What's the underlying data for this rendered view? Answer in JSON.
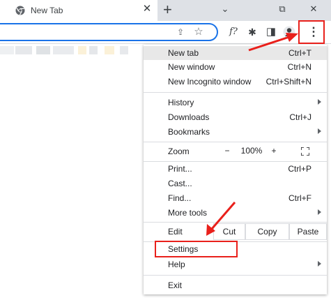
{
  "tab": {
    "title": "New Tab",
    "close": "✕",
    "new_tab": "+"
  },
  "window": {
    "minimize": "⌄",
    "maximize": "⧉",
    "close": "✕"
  },
  "toolbar": {
    "share_glyph": "⇪",
    "bookmark_glyph": "☆",
    "ext_f": "f?",
    "puzzle_glyph": "✱",
    "sidepanel_glyph": "◨",
    "kebab_glyph": "⋮"
  },
  "menu": {
    "group1": [
      {
        "label": "New tab",
        "shortcut": "Ctrl+T"
      },
      {
        "label": "New window",
        "shortcut": "Ctrl+N"
      },
      {
        "label": "New Incognito window",
        "shortcut": "Ctrl+Shift+N"
      }
    ],
    "group2": [
      {
        "label": "History",
        "shortcut": ""
      },
      {
        "label": "Downloads",
        "shortcut": "Ctrl+J"
      },
      {
        "label": "Bookmarks",
        "shortcut": ""
      }
    ],
    "zoom": {
      "label": "Zoom",
      "minus": "−",
      "value": "100%",
      "plus": "+"
    },
    "group3": [
      {
        "label": "Print...",
        "shortcut": "Ctrl+P"
      },
      {
        "label": "Cast...",
        "shortcut": ""
      },
      {
        "label": "Find...",
        "shortcut": "Ctrl+F"
      },
      {
        "label": "More tools",
        "shortcut": ""
      }
    ],
    "edit": {
      "label": "Edit",
      "cut": "Cut",
      "copy": "Copy",
      "paste": "Paste"
    },
    "settings": {
      "label": "Settings"
    },
    "help": {
      "label": "Help"
    },
    "exit": {
      "label": "Exit"
    }
  },
  "colors": {
    "annotation": "#e9201b",
    "accent": "#1a73e8"
  }
}
